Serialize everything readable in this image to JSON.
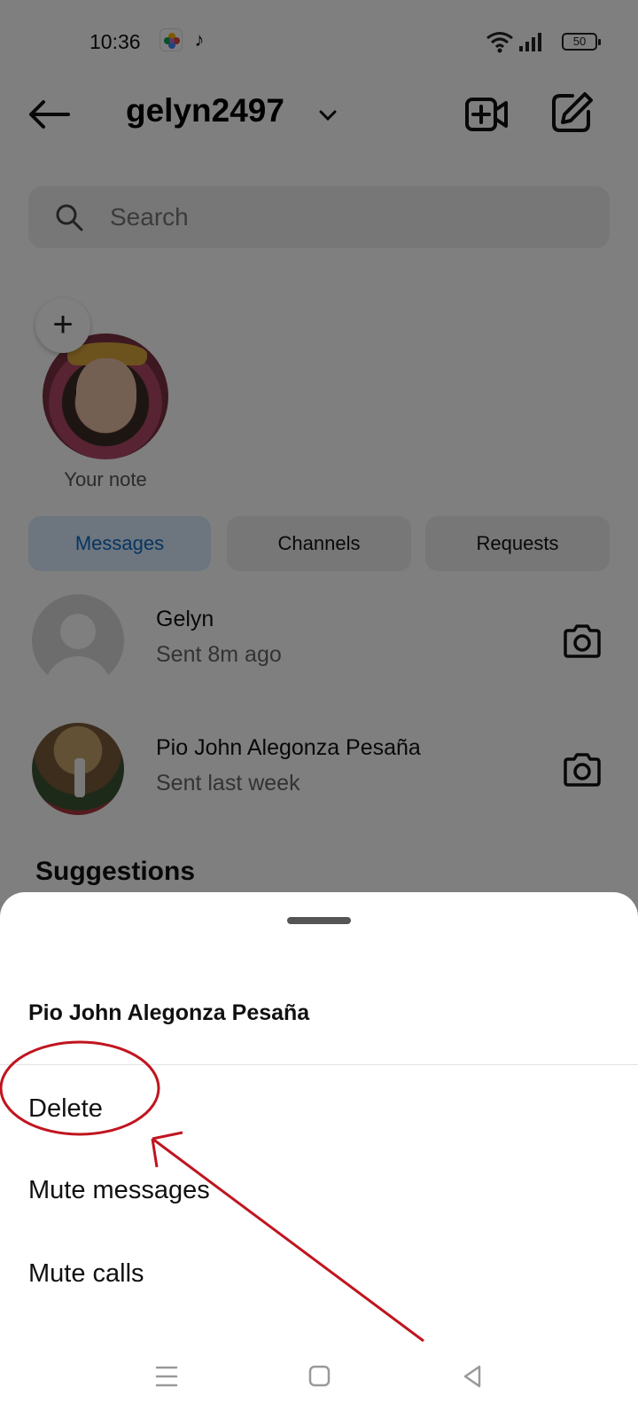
{
  "status_bar": {
    "time": "10:36",
    "battery": "50"
  },
  "header": {
    "account_name": "gelyn2497",
    "icons": [
      "back-arrow-icon",
      "chevron-down-icon",
      "video-plus-icon",
      "compose-icon"
    ]
  },
  "search": {
    "placeholder": "Search"
  },
  "note": {
    "label": "Your note"
  },
  "tabs": [
    {
      "label": "Messages",
      "active": true
    },
    {
      "label": "Channels",
      "active": false
    },
    {
      "label": "Requests",
      "active": false
    }
  ],
  "conversations": [
    {
      "name": "Gelyn",
      "status": "Sent 8m ago"
    },
    {
      "name": "Pio John Alegonza Pesaña",
      "status": "Sent last week"
    }
  ],
  "suggestions_heading": "Suggestions",
  "sheet": {
    "title": "Pio John Alegonza Pesaña",
    "items": [
      "Delete",
      "Mute messages",
      "Mute calls"
    ]
  },
  "colors": {
    "accent_blue": "#0d6ac1",
    "annotation_red": "#c0151f",
    "overlay": "rgba(0,0,0,0.5)"
  }
}
